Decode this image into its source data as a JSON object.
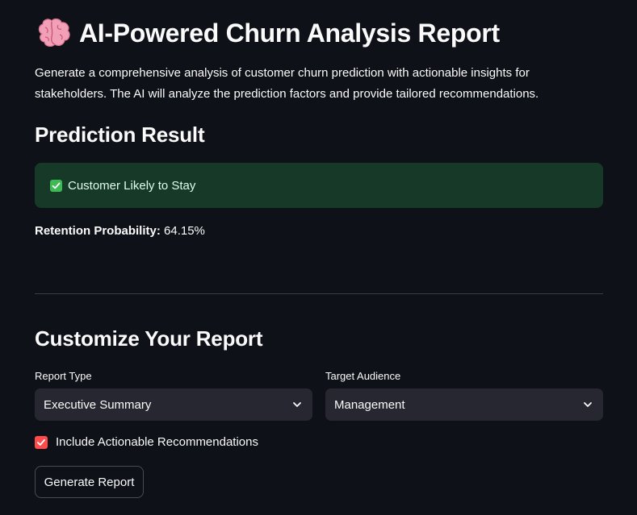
{
  "header": {
    "icon": "brain-icon",
    "title": "AI-Powered Churn Analysis Report",
    "intro": "Generate a comprehensive analysis of customer churn prediction with actionable insights for stakeholders. The AI will analyze the prediction factors and provide tailored recommendations."
  },
  "prediction": {
    "heading": "Prediction Result",
    "result_icon": "check-icon",
    "result_text": "Customer Likely to Stay",
    "probability_label": "Retention Probability:",
    "probability_value": "64.15%"
  },
  "customize": {
    "heading": "Customize Your Report",
    "report_type": {
      "label": "Report Type",
      "value": "Executive Summary"
    },
    "target_audience": {
      "label": "Target Audience",
      "value": "Management"
    },
    "include_recommendations": {
      "label": "Include Actionable Recommendations",
      "checked": true
    },
    "generate_button_label": "Generate Report"
  },
  "colors": {
    "background": "#0e1117",
    "success_bg": "#173928",
    "success_check": "#3dba55",
    "checkbox_accent": "#ff4b4b",
    "select_bg": "#262730"
  }
}
